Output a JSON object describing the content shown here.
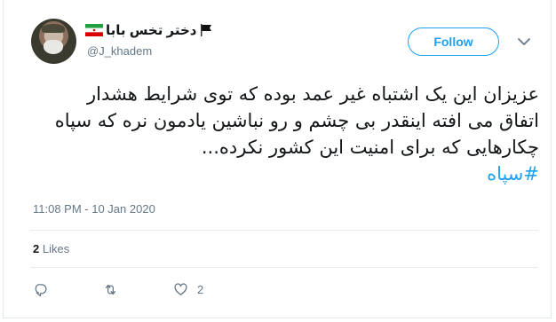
{
  "user": {
    "display_name": "دختر تخس بابا",
    "handle": "@J_khadem",
    "flags": [
      "iran-flag-icon",
      "black-flag-icon"
    ]
  },
  "follow_button": {
    "label": "Follow"
  },
  "tweet": {
    "lines": [
      "عزیزان این یک اشتباه غیر عمد بوده که توی شرایط هشدار",
      "اتفاق می افته اینقدر بی چشم و رو نباشین یادمون نره که سپاه",
      "چکارهایی که برای امنیت این کشور نکرده..."
    ],
    "hashtag": "#سپاه"
  },
  "timestamp": "11:08 PM - 10 Jan 2020",
  "stats": {
    "likes_count": "2",
    "likes_label": "Likes"
  },
  "actions": {
    "reply_icon": "reply-icon",
    "retweet_icon": "retweet-icon",
    "like_icon": "heart-icon",
    "like_count": "2"
  },
  "colors": {
    "accent": "#1da1f2",
    "secondary_text": "#657786",
    "border": "#e1e8ed"
  }
}
